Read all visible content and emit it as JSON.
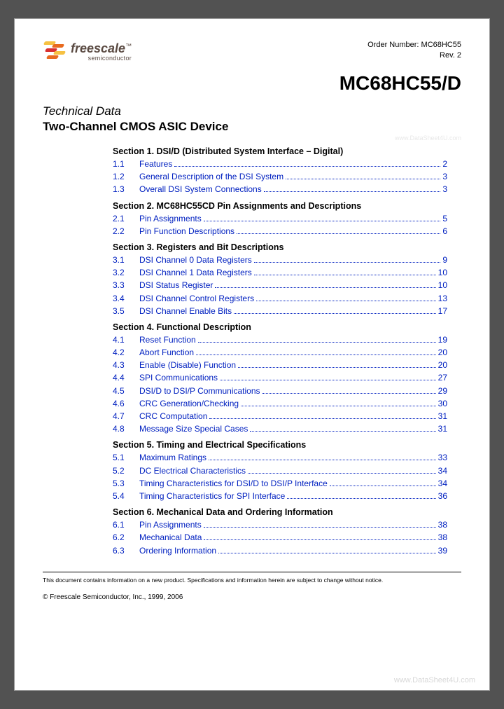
{
  "header": {
    "logo_main": "freescale",
    "logo_tm": "™",
    "logo_sub": "semiconductor",
    "order_label": "Order Number: MC68HC55",
    "rev": "Rev. 2"
  },
  "doc_title": "MC68HC55/D",
  "tech_data_label": "Technical Data",
  "subtitle": "Two-Channel CMOS ASIC Device",
  "watermark_top": "www.DataSheet4U.com",
  "watermark_bottom": "www.DataSheet4U.com",
  "sections": [
    {
      "title": "Section 1. DSI/D (Distributed System Interface – Digital)",
      "items": [
        {
          "num": "1.1",
          "label": "Features",
          "page": "2"
        },
        {
          "num": "1.2",
          "label": "General Description of the DSI System",
          "page": "3"
        },
        {
          "num": "1.3",
          "label": "Overall DSI System Connections",
          "page": "3"
        }
      ]
    },
    {
      "title": "Section 2. MC68HC55CD Pin Assignments and Descriptions",
      "items": [
        {
          "num": "2.1",
          "label": "Pin Assignments",
          "page": "5"
        },
        {
          "num": "2.2",
          "label": "Pin Function Descriptions",
          "page": "6"
        }
      ]
    },
    {
      "title": "Section 3. Registers and Bit Descriptions",
      "items": [
        {
          "num": "3.1",
          "label": "DSI Channel 0 Data Registers",
          "page": "9"
        },
        {
          "num": "3.2",
          "label": "DSI Channel 1 Data Registers",
          "page": "10"
        },
        {
          "num": "3.3",
          "label": "DSI Status Register",
          "page": "10"
        },
        {
          "num": "3.4",
          "label": "DSI Channel Control Registers",
          "page": "13"
        },
        {
          "num": "3.5",
          "label": "DSI Channel Enable Bits",
          "page": "17"
        }
      ]
    },
    {
      "title": "Section 4. Functional Description",
      "items": [
        {
          "num": "4.1",
          "label": "Reset Function",
          "page": "19"
        },
        {
          "num": "4.2",
          "label": "Abort Function",
          "page": "20"
        },
        {
          "num": "4.3",
          "label": "Enable (Disable) Function",
          "page": "20"
        },
        {
          "num": "4.4",
          "label": "SPI Communications",
          "page": "27"
        },
        {
          "num": "4.5",
          "label": "DSI/D to DSI/P Communications",
          "page": "29"
        },
        {
          "num": "4.6",
          "label": "CRC Generation/Checking",
          "page": "30"
        },
        {
          "num": "4.7",
          "label": "CRC Computation",
          "page": "31"
        },
        {
          "num": "4.8",
          "label": "Message Size Special Cases",
          "page": "31"
        }
      ]
    },
    {
      "title": "Section 5. Timing and Electrical Specifications",
      "items": [
        {
          "num": "5.1",
          "label": "Maximum Ratings",
          "page": "33"
        },
        {
          "num": "5.2",
          "label": "DC Electrical Characteristics",
          "page": "34"
        },
        {
          "num": "5.3",
          "label": "Timing Characteristics for DSI/D to DSI/P Interface",
          "page": "34"
        },
        {
          "num": "5.4",
          "label": "Timing Characteristics for SPI Interface",
          "page": "36"
        }
      ]
    },
    {
      "title": "Section 6. Mechanical Data and Ordering Information",
      "items": [
        {
          "num": "6.1",
          "label": "Pin Assignments",
          "page": "38"
        },
        {
          "num": "6.2",
          "label": "Mechanical Data",
          "page": "38"
        },
        {
          "num": "6.3",
          "label": "Ordering Information",
          "page": "39"
        }
      ]
    }
  ],
  "disclaimer": "This document contains information on a new product. Specifications and information herein are subject to change without notice.",
  "copyright": "© Freescale Semiconductor, Inc., 1999, 2006"
}
